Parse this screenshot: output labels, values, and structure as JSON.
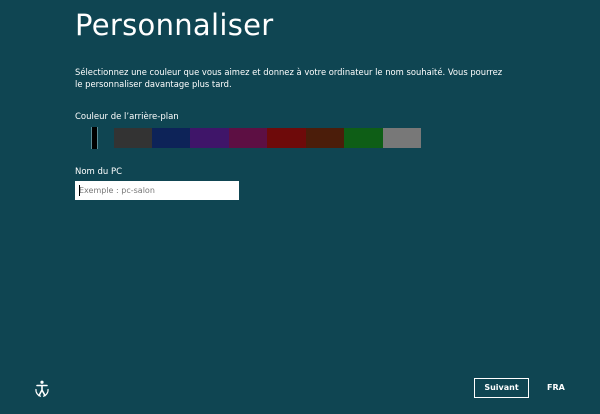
{
  "page": {
    "title": "Personnaliser",
    "intro": "Sélectionnez une couleur que vous aimez et donnez à votre ordinateur le nom souhaité. Vous pourrez le personnaliser davantage plus tard."
  },
  "background_color": {
    "label": "Couleur de l’arrière-plan",
    "selected": "#0f4552",
    "swatches": [
      "#0f4552",
      "#333333",
      "#0d2358",
      "#3f1569",
      "#5d0f43",
      "#6e0a0a",
      "#4b1d0a",
      "#0e5e16",
      "#787878"
    ]
  },
  "pc_name": {
    "label": "Nom du PC",
    "placeholder": "Exemple : pc-salon",
    "value": ""
  },
  "footer": {
    "accessibility_icon": "ease-of-access-icon",
    "next_label": "Suivant",
    "language": "FRA"
  }
}
